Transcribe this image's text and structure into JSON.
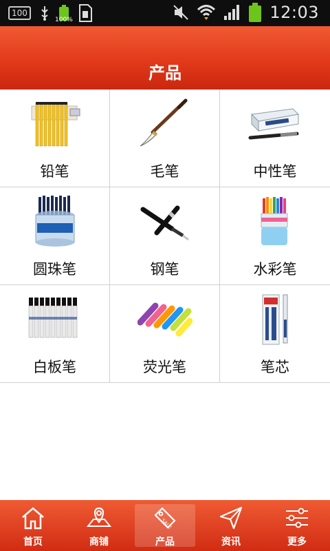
{
  "status_bar": {
    "left_chip": "100",
    "battery_small_pct": "100%",
    "time": "12:03"
  },
  "header": {
    "title": "产品"
  },
  "products": [
    {
      "label": "铅笔",
      "icon": "pencil-box-image"
    },
    {
      "label": "毛笔",
      "icon": "calligraphy-brush-image"
    },
    {
      "label": "中性笔",
      "icon": "gel-pen-box-image"
    },
    {
      "label": "圆珠笔",
      "icon": "ballpoint-pen-tub-image"
    },
    {
      "label": "钢笔",
      "icon": "fountain-pen-image"
    },
    {
      "label": "水彩笔",
      "icon": "watercolor-pen-tub-image"
    },
    {
      "label": "白板笔",
      "icon": "whiteboard-marker-set-image"
    },
    {
      "label": "荧光笔",
      "icon": "highlighter-set-image"
    },
    {
      "label": "笔芯",
      "icon": "pen-refill-pack-image"
    }
  ],
  "bottom_nav": [
    {
      "label": "首页",
      "icon": "home-icon"
    },
    {
      "label": "商铺",
      "icon": "map-shop-icon"
    },
    {
      "label": "产品",
      "icon": "sale-tag-icon"
    },
    {
      "label": "资讯",
      "icon": "paper-plane-icon"
    },
    {
      "label": "更多",
      "icon": "sliders-icon"
    }
  ],
  "colors": {
    "accent": "#e23a1a",
    "statusbar": "#0e0e0e",
    "battery": "#6dc51c"
  }
}
